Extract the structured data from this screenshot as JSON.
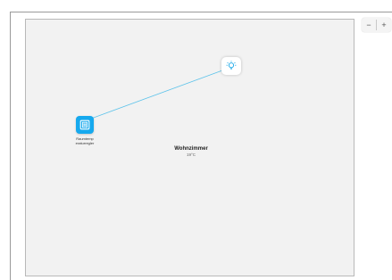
{
  "colors": {
    "device_blue": "#16a9ee",
    "link_line": "#5cc3ea",
    "canvas_bg": "#f2f2f2"
  },
  "canvas": {
    "room_name": "Wohnzimmer",
    "room_temperature": "19°C"
  },
  "nodes": [
    {
      "icon": "thermostat-icon",
      "label_line1": "Raumtemp",
      "label_line2": "eraturregler"
    },
    {
      "icon": "lightbulb-icon",
      "label_line1": "",
      "label_line2": ""
    }
  ],
  "zoom": {
    "minus_label": "−",
    "plus_label": "+"
  }
}
